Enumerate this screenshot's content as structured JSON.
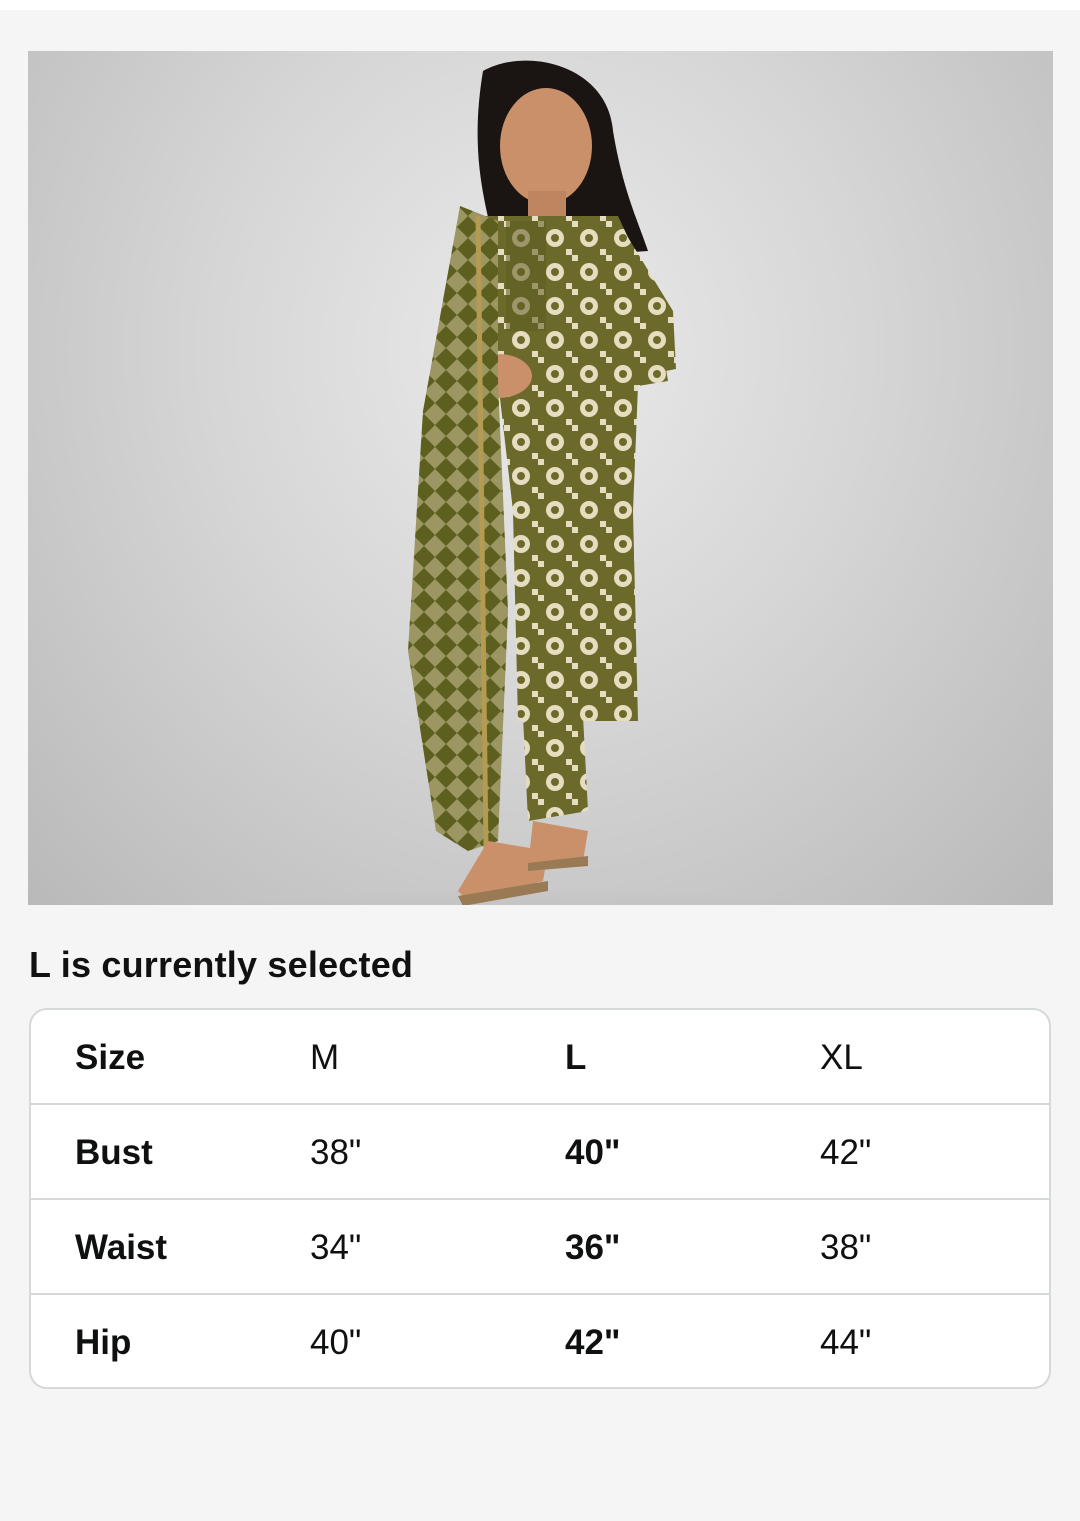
{
  "product_image": {
    "alt": "Woman wearing olive green printed kurta set with dupatta"
  },
  "selection": {
    "label": "L is currently selected"
  },
  "size_chart": {
    "rows": [
      {
        "label": "Size",
        "M": "M",
        "L": "L",
        "XL": "XL"
      },
      {
        "label": "Bust",
        "M": "38\"",
        "L": "40\"",
        "XL": "42\""
      },
      {
        "label": "Waist",
        "M": "34\"",
        "L": "36\"",
        "XL": "38\""
      },
      {
        "label": "Hip",
        "M": "40\"",
        "L": "42\"",
        "XL": "44\""
      }
    ],
    "selected_column": "L"
  },
  "colors": {
    "kurta_olive": "#6b6a2a",
    "kurta_cream": "#e6dcc0",
    "table_border": "#d5d9d9",
    "page_bg": "#f5f5f5"
  }
}
